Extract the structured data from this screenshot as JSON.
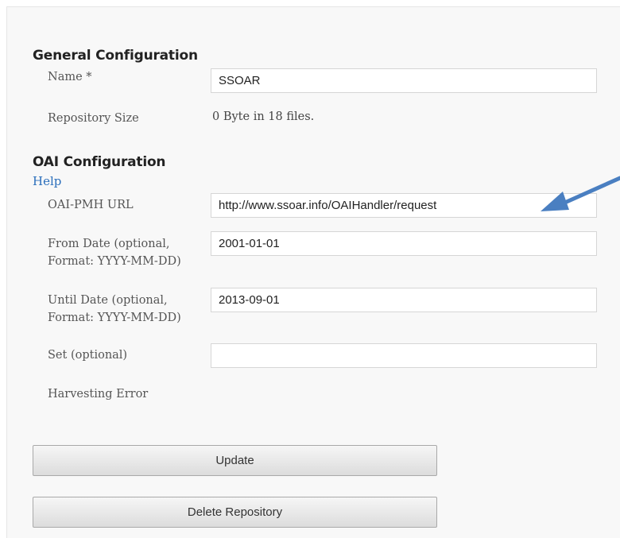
{
  "general": {
    "title": "General Configuration",
    "name_label": "Name *",
    "name_value": "SSOAR",
    "size_label": "Repository Size",
    "size_value": "0 Byte in 18 files."
  },
  "oai": {
    "title": "OAI Configuration",
    "help_label": "Help",
    "url_label": "OAI-PMH URL",
    "url_value": "http://www.ssoar.info/OAIHandler/request",
    "from_label_line1": "From Date (optional,",
    "from_label_line2": "Format: YYYY-MM-DD)",
    "from_value": "2001-01-01",
    "until_label_line1": "Until Date (optional,",
    "until_label_line2": "Format: YYYY-MM-DD)",
    "until_value": "2013-09-01",
    "set_label": "Set (optional)",
    "set_value": "",
    "error_label": "Harvesting Error"
  },
  "actions": {
    "update_label": "Update",
    "delete_label": "Delete Repository"
  },
  "annotation": {
    "arrow_color": "#4a7fc1"
  }
}
